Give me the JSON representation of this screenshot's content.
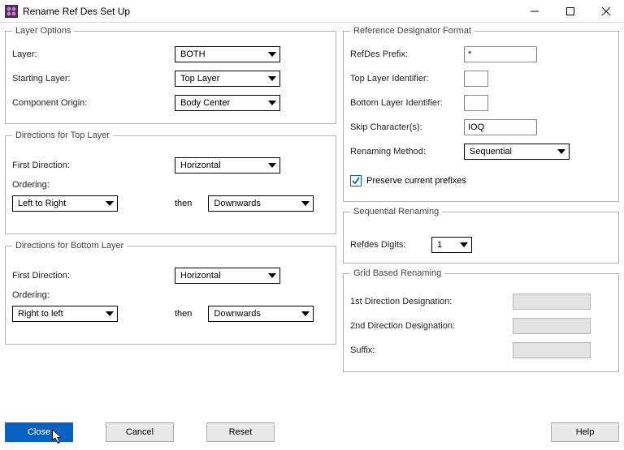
{
  "window": {
    "title": "Rename Ref Des Set Up"
  },
  "layerOptions": {
    "legend": "Layer Options",
    "layerLabel": "Layer:",
    "layerValue": "BOTH",
    "startingLayerLabel": "Starting Layer:",
    "startingLayerValue": "Top Layer",
    "componentOriginLabel": "Component Origin:",
    "componentOriginValue": "Body Center"
  },
  "topDirections": {
    "legend": "Directions for Top Layer",
    "firstDirLabel": "First Direction:",
    "firstDirValue": "Horizontal",
    "orderingLabel": "Ordering:",
    "order1": "Left to Right",
    "then": "then",
    "order2": "Downwards"
  },
  "bottomDirections": {
    "legend": "Directions for Bottom Layer",
    "firstDirLabel": "First Direction:",
    "firstDirValue": "Horizontal",
    "orderingLabel": "Ordering:",
    "order1": "Right to left",
    "then": "then",
    "order2": "Downwards"
  },
  "refDesFormat": {
    "legend": "Reference Designator Format",
    "prefixLabel": "RefDes Prefix:",
    "prefixVal": "*",
    "topIdLabel": "Top Layer Identifier:",
    "topIdVal": "",
    "botIdLabel": "Bottom Layer Identifier:",
    "botIdVal": "",
    "skipLabel": "Skip Character(s):",
    "skipVal": "IOQ",
    "methodLabel": "Renaming Method:",
    "methodVal": "Sequential",
    "preserveLabel": "Preserve current prefixes"
  },
  "sequential": {
    "legend": "Sequential Renaming",
    "digitsLabel": "Refdes Digits:",
    "digitsValue": "1"
  },
  "grid": {
    "legend": "Grid Based Renaming",
    "d1Label": "1st Direction Designation:",
    "d2Label": "2nd Direction Designation:",
    "suffixLabel": "Suffix:"
  },
  "buttons": {
    "close": "Close",
    "cancel": "Cancel",
    "reset": "Reset",
    "help": "Help"
  }
}
